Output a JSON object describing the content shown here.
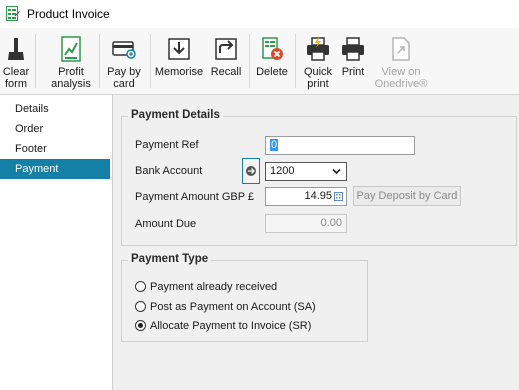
{
  "window": {
    "title": "Product Invoice"
  },
  "toolbar": {
    "clear_form": "Clear form",
    "profit_analysis": "Profit analysis",
    "pay_by_card": "Pay by card",
    "memorise": "Memorise",
    "recall": "Recall",
    "delete": "Delete",
    "quick_print": "Quick print",
    "print": "Print",
    "view_onedrive": "View on Onedrive®"
  },
  "sidebar": {
    "items": [
      {
        "label": "Details",
        "active": false
      },
      {
        "label": "Order",
        "active": false
      },
      {
        "label": "Footer",
        "active": false
      },
      {
        "label": "Payment",
        "active": true
      }
    ]
  },
  "payment_details": {
    "heading": "Payment Details",
    "payment_ref_label": "Payment Ref",
    "payment_ref_value": "0",
    "bank_account_label": "Bank Account",
    "bank_account_value": "1200",
    "amount_label": "Payment Amount GBP £",
    "amount_value": "14.95",
    "pay_deposit_button": "Pay Deposit by Card",
    "amount_due_label": "Amount Due",
    "amount_due_value": "0.00"
  },
  "payment_type": {
    "heading": "Payment Type",
    "options": [
      {
        "label": "Payment already received",
        "checked": false
      },
      {
        "label": "Post as Payment on Account (SA)",
        "checked": false
      },
      {
        "label": "Allocate Payment to Invoice (SR)",
        "checked": true
      }
    ]
  },
  "colors": {
    "accent": "#1580a6",
    "delete": "#d9492b",
    "brand_green": "#2e9c4a"
  }
}
